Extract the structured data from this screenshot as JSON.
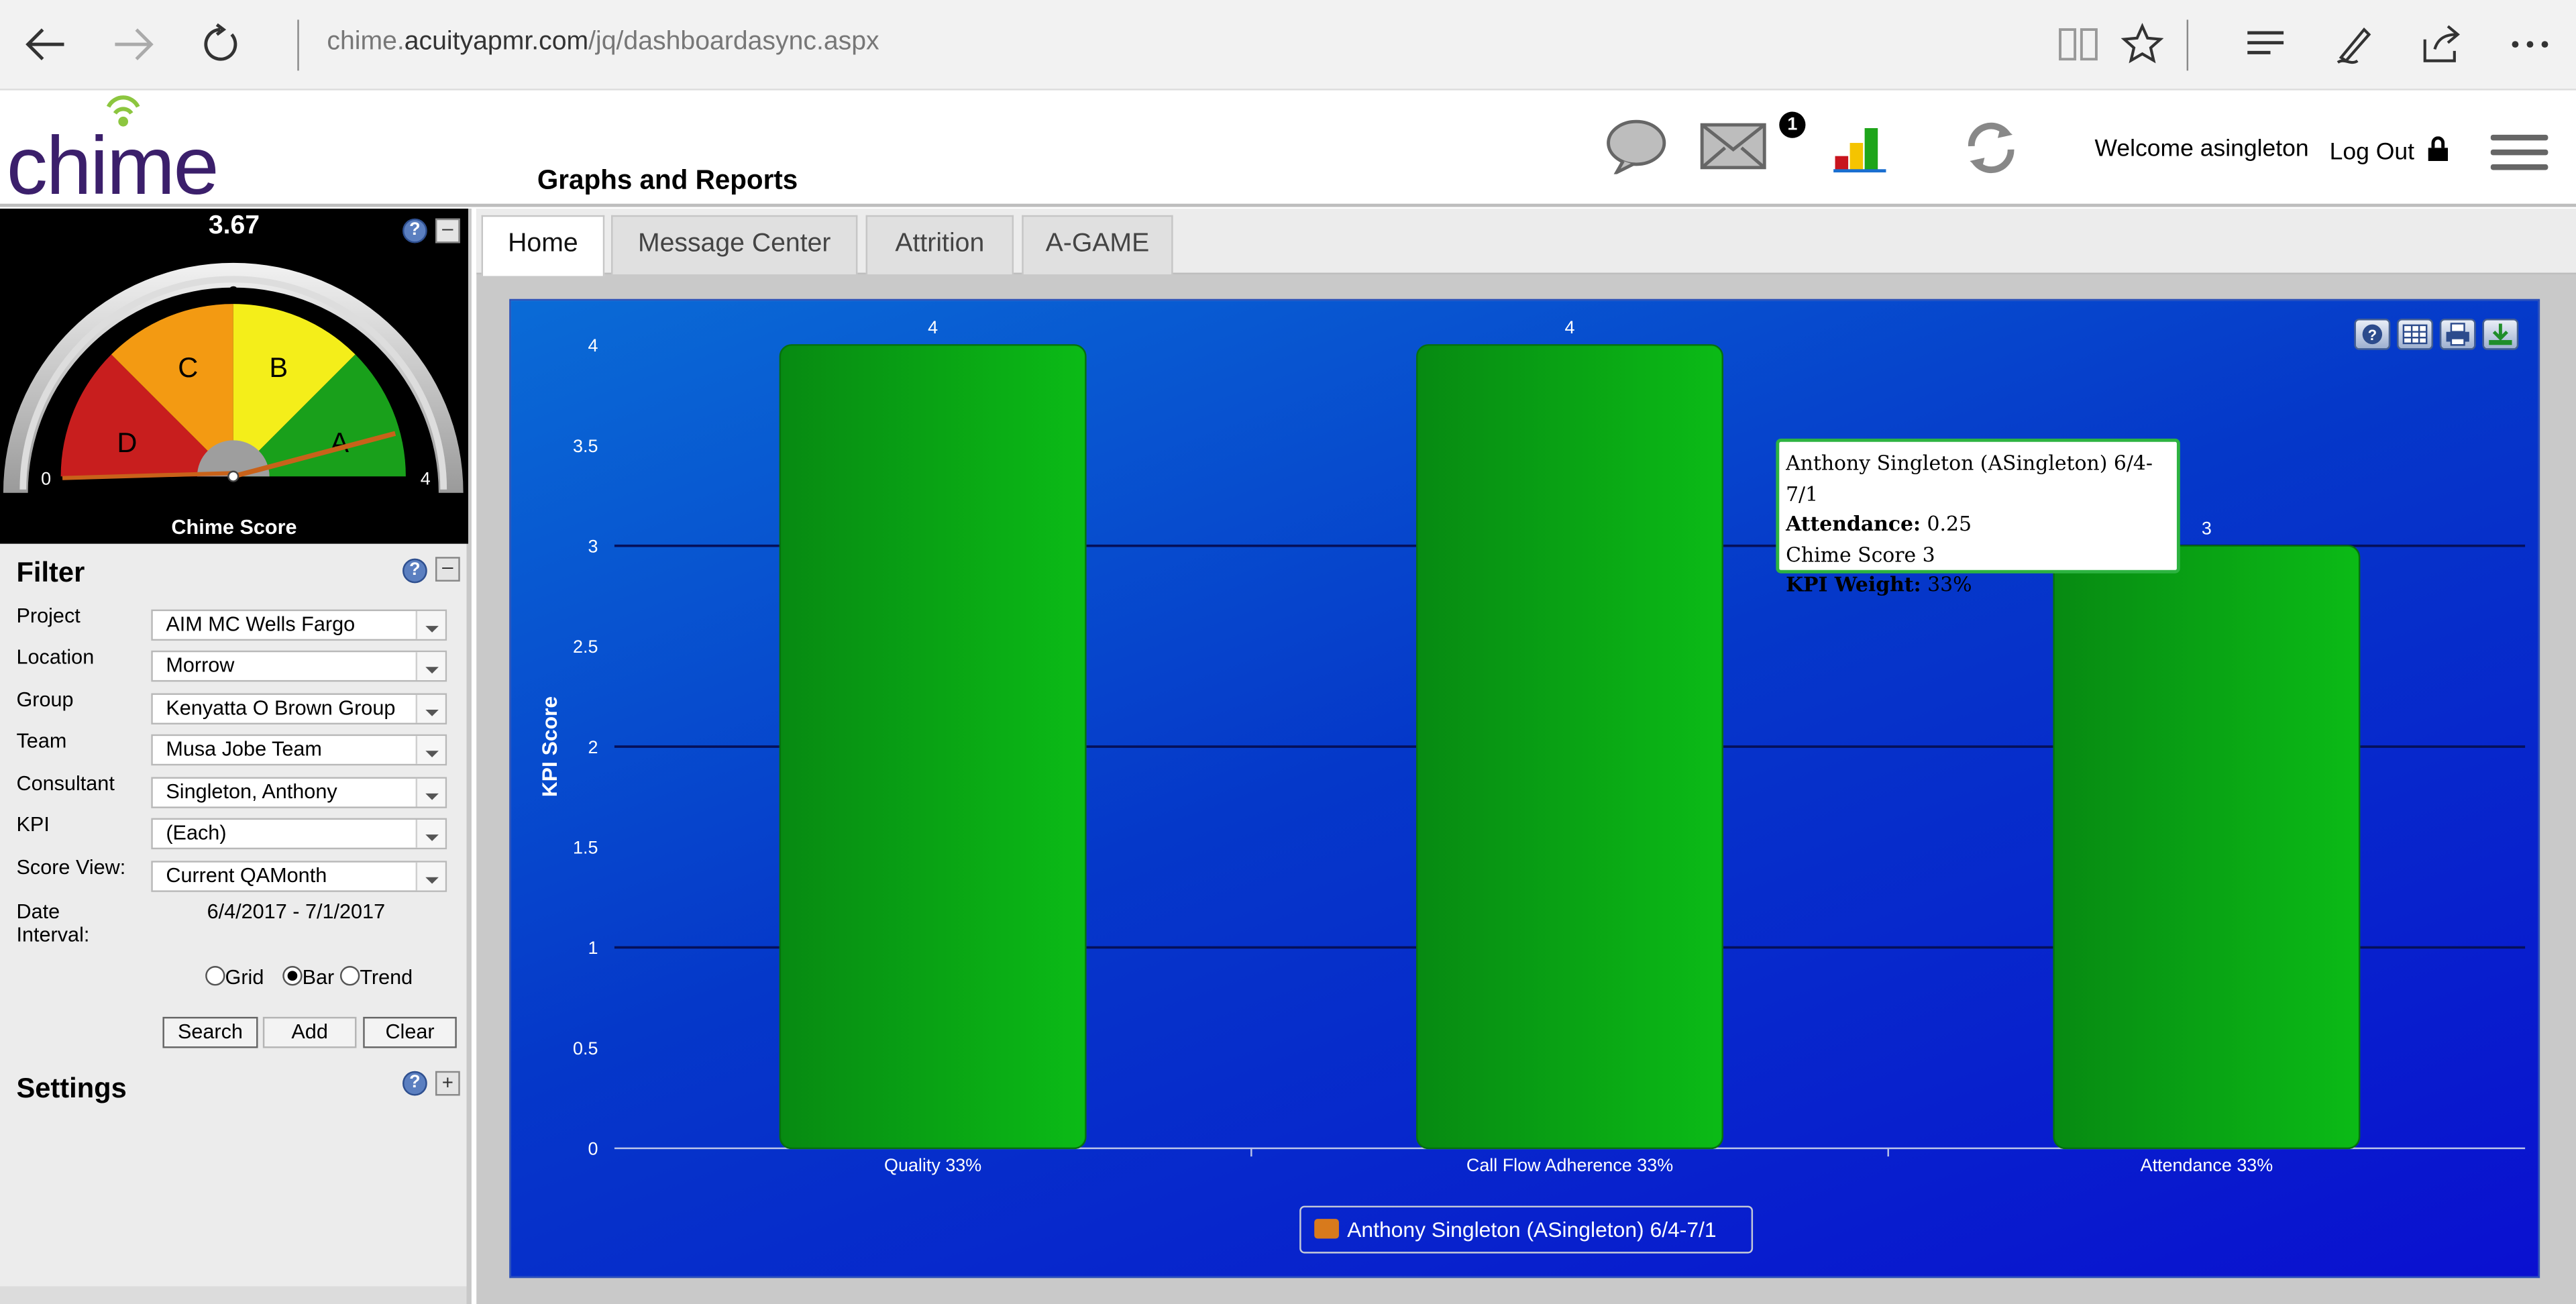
{
  "browser": {
    "url_prefix": "chime.",
    "url_domain": "acuityapmr.com",
    "url_path": "/jq/dashboardasync.aspx"
  },
  "header": {
    "logo_text": "chime",
    "page_title": "Graphs and Reports",
    "mail_badge": "1",
    "welcome": "Welcome asingleton",
    "logout": "Log Out"
  },
  "gauge": {
    "score": "3.67",
    "caption": "Chime Score",
    "ticks": [
      "0",
      "1",
      "2",
      "3",
      "4"
    ],
    "zones": [
      "D",
      "C",
      "B",
      "A"
    ],
    "value": 3.67,
    "colors": {
      "D": "#c81e1e",
      "C": "#f39a12",
      "B": "#f4ee1a",
      "A": "#19a01b"
    }
  },
  "filter": {
    "title": "Filter",
    "rows": [
      {
        "label": "Project",
        "value": "AIM MC Wells Fargo"
      },
      {
        "label": "Location",
        "value": "Morrow"
      },
      {
        "label": "Group",
        "value": "Kenyatta O Brown Group"
      },
      {
        "label": "Team",
        "value": "Musa Jobe Team"
      },
      {
        "label": "Consultant",
        "value": "Singleton, Anthony"
      },
      {
        "label": "KPI",
        "value": "(Each)"
      },
      {
        "label": "Score View:",
        "value": "Current QAMonth"
      }
    ],
    "date_label_1": "Date",
    "date_label_2": "Interval:",
    "date_value": "6/4/2017 - 7/1/2017",
    "views": [
      "Grid",
      "Bar",
      "Trend"
    ],
    "selected_view": "Bar",
    "buttons": {
      "search": "Search",
      "add": "Add",
      "clear": "Clear"
    }
  },
  "settings": {
    "title": "Settings"
  },
  "tabs": [
    "Home",
    "Message Center",
    "Attrition",
    "A-GAME"
  ],
  "active_tab": "Home",
  "tooltip": {
    "line1": "Anthony Singleton (ASingleton) 6/4-7/1",
    "line2_label": "Attendance:",
    "line2_value": "0.25",
    "line3": "Chime Score 3",
    "line4_label": "KPI Weight:",
    "line4_value": "33%"
  },
  "chart_data": {
    "type": "bar",
    "categories": [
      "Quality 33%",
      "Call Flow Adherence 33%",
      "Attendance 33%"
    ],
    "series": [
      {
        "name": "Anthony Singleton (ASingleton) 6/4-7/1",
        "values": [
          4,
          4,
          3
        ]
      }
    ],
    "data_labels": [
      "4",
      "4",
      "3"
    ],
    "ylabel": "KPI Score",
    "xlabel": "",
    "ylim": [
      0,
      4
    ],
    "yticks": [
      "0",
      "0.5",
      "1",
      "1.5",
      "2",
      "2.5",
      "3",
      "3.5",
      "4"
    ],
    "grid": true,
    "legend_position": "bottom-center",
    "colors": {
      "bar": "#0aa814",
      "legend_swatch": "#d87a1c",
      "background": "#0535c8"
    }
  }
}
